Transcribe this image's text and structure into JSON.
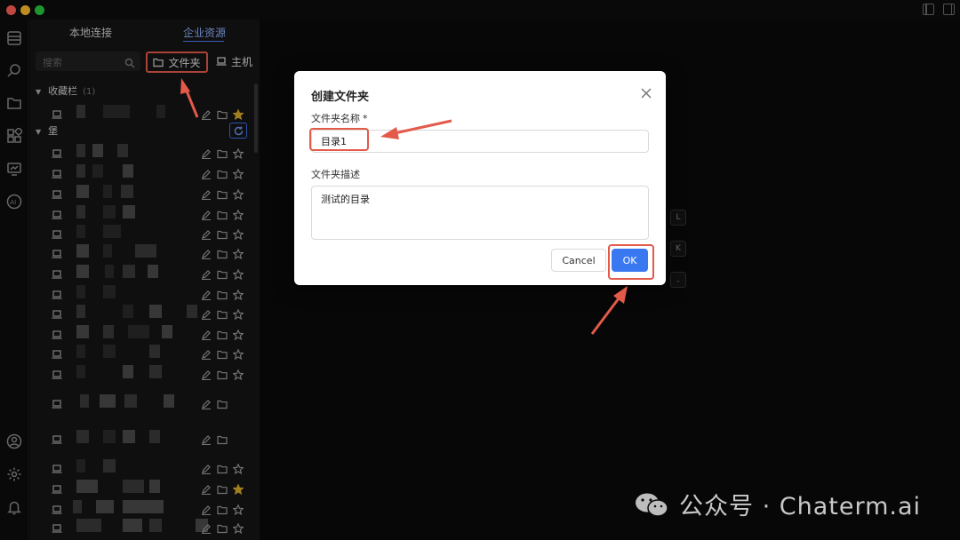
{
  "sidebar": {
    "tabs": [
      {
        "label": "本地连接"
      },
      {
        "label": "企业资源"
      }
    ],
    "search_placeholder": "搜索",
    "folder_button": "文件夹",
    "host_button": "主机",
    "favorites": {
      "label": "收藏栏",
      "count": "(1)"
    },
    "bastion": {
      "label": "堡"
    }
  },
  "main": {
    "kbd_keys": [
      "L",
      "K",
      ","
    ]
  },
  "dialog": {
    "title": "创建文件夹",
    "name_label": "文件夹名称",
    "name_required": "*",
    "name_value": "目录1",
    "desc_label": "文件夹描述",
    "desc_value": "测试的目录",
    "cancel": "Cancel",
    "ok": "OK"
  },
  "watermark": {
    "text": "公众号 · Chaterm.ai"
  },
  "colors": {
    "accent": "#3a78f2",
    "annotation": "#e35a4a",
    "star": "#d8a92b"
  }
}
